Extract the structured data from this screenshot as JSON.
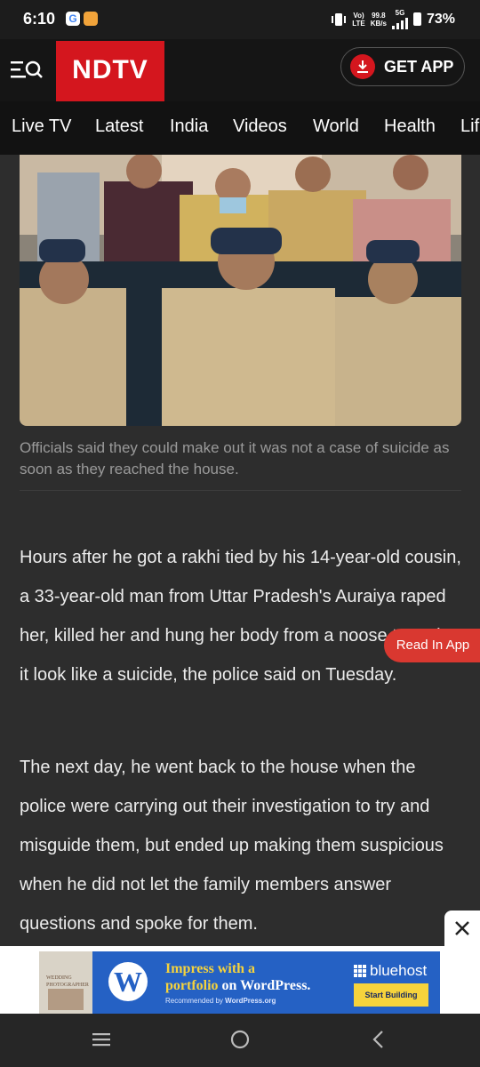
{
  "status_bar": {
    "time": "6:10",
    "google_glyph": "G",
    "net_top": "Vo)",
    "net_bottom": "LTE",
    "speed_top": "99.8",
    "speed_bottom": "KB/s",
    "signal_label": "5G",
    "battery": "73%"
  },
  "header": {
    "logo_text": "NDTV",
    "get_app_label": "GET APP"
  },
  "nav": {
    "tabs": [
      "Live TV",
      "Latest",
      "India",
      "Videos",
      "World",
      "Health",
      "Lif"
    ]
  },
  "article": {
    "caption": "Officials said they could make out it was not a case of suicide as soon as they reached the house.",
    "paragraphs": [
      "Hours after he got a rakhi tied by his 14-year-old cousin, a 33-year-old man from Uttar Pradesh's Auraiya raped her, killed her and hung her body from a noose to make it look like a suicide, the police said on Tuesday.",
      "The next day, he went back to the house when the police were carrying out their investigation to try and misguide them, but ended up making them suspicious when he did not let the family members answer questions and spoke for them."
    ]
  },
  "read_in_app_label": "Read In App",
  "ad": {
    "headline_1": "Impress with a",
    "headline_2": "portfolio",
    "headline_3": "on WordPress.",
    "recommended": "Recommended by",
    "recommended_brand": "WordPress.org",
    "brand": "bluehost",
    "cta": "Start Building",
    "thumb_text": "WEDDING PHOTOGRAPHER",
    "wp_glyph": "W"
  },
  "icons": [
    "menu-search-icon",
    "download-icon",
    "close-icon",
    "recents-icon",
    "home-icon",
    "back-icon"
  ]
}
